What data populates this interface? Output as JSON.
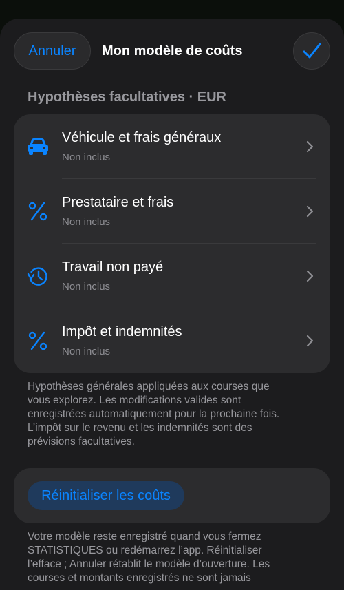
{
  "header": {
    "cancel_label": "Annuler",
    "title": "Mon modèle de coûts",
    "confirm_icon": "checkmark-icon"
  },
  "section": {
    "title": "Hypothèses facultatives · EUR"
  },
  "items": [
    {
      "label": "Véhicule et frais généraux",
      "status": "Non inclus",
      "icon": "car-icon"
    },
    {
      "label": "Prestataire et frais",
      "status": "Non inclus",
      "icon": "percent-icon"
    },
    {
      "label": "Travail non payé",
      "status": "Non inclus",
      "icon": "clock-history-icon"
    },
    {
      "label": "Impôt et indemnités",
      "status": "Non inclus",
      "icon": "percent-icon"
    }
  ],
  "footnote1": [
    "Hypothèses générales appliquées aux courses que",
    "vous explorez. Les modifications valides sont",
    "enregistrées automatiquement pour la prochaine fois.",
    "L’impôt sur le revenu et les indemnités sont des",
    "prévisions facultatives."
  ],
  "reset": {
    "label": "Réinitialiser les coûts"
  },
  "footnote2": [
    "Votre modèle reste enregistré quand vous fermez",
    "STATISTIQUES ou redémarrez l’app. Réinitialiser",
    "l’efface ; Annuler rétablit le modèle d’ouverture. Les",
    "courses et montants enregistrés ne sont jamais"
  ],
  "colors": {
    "accent": "#0a84ff",
    "background": "#1c1c1e",
    "card": "#2c2c2e",
    "secondary_text": "#8e8e93"
  }
}
